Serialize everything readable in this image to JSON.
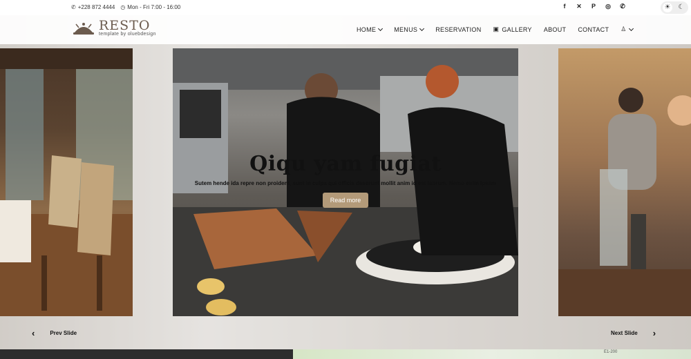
{
  "topbar": {
    "phone": "+228 872 4444",
    "hours": "Mon - Fri 7:00 - 16:00",
    "socials": [
      "facebook-icon",
      "x-icon",
      "pinterest-icon",
      "instagram-icon",
      "whatsapp-icon"
    ],
    "theme": [
      "light",
      "dark"
    ]
  },
  "brand": {
    "title": "RESTO",
    "subtitle": "template by oluebdesign"
  },
  "nav": {
    "items": [
      {
        "label": "HOME",
        "dropdown": true
      },
      {
        "label": "MENUS",
        "dropdown": true
      },
      {
        "label": "RESERVATION",
        "dropdown": false
      },
      {
        "label": "GALLERY",
        "dropdown": false
      },
      {
        "label": "ABOUT",
        "dropdown": false
      },
      {
        "label": "CONTACT",
        "dropdown": false
      }
    ]
  },
  "slide": {
    "heading": "Qiqu yam fugiat",
    "text": "Sutem hende ida repre non proident, sunt in culpa qui officia deserunt mollit anim id est labrum. Nemo enim ipsam",
    "button": "Read more"
  },
  "slider_nav": {
    "prev": "Prev Slide",
    "next": "Next Slide"
  },
  "map": {
    "label": "E1-200"
  },
  "colors": {
    "accent": "#b39a79",
    "logo": "#6b5b4e"
  }
}
